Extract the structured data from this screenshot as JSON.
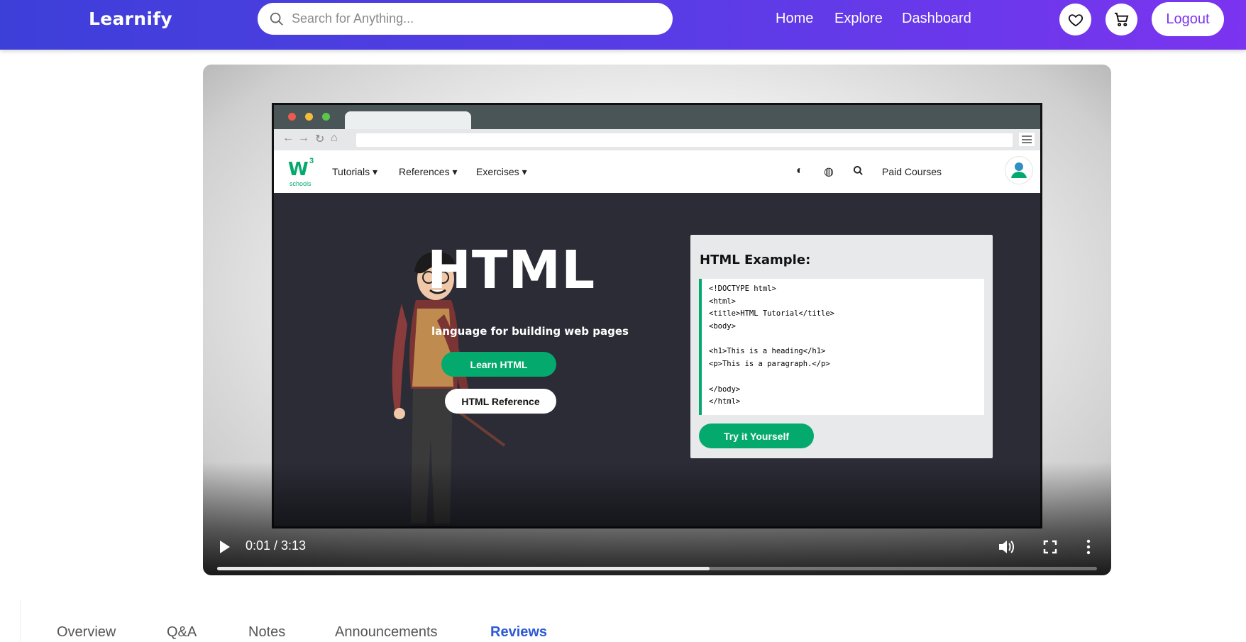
{
  "brand": "Learnify",
  "search": {
    "placeholder": "Search for Anything..."
  },
  "nav": {
    "home": "Home",
    "explore": "Explore",
    "dashboard": "Dashboard"
  },
  "actions": {
    "logout": "Logout",
    "wishlist_icon": "heart-icon",
    "cart_icon": "cart-icon"
  },
  "video": {
    "time": "0:01 / 3:13",
    "progress_buffered": 0.56,
    "frame": {
      "w3_nav": [
        "Tutorials",
        "References",
        "Exercises"
      ],
      "w3_right": "Paid Courses",
      "w3_logo": "schools",
      "hero_title": "HTML",
      "hero_subtitle": "language for building web pages",
      "learn_button": "Learn HTML",
      "reference_button": "HTML Reference",
      "example_title": "HTML Example:",
      "code": [
        "<!DOCTYPE html>",
        "<html>",
        "<title>HTML Tutorial</title>",
        "<body>",
        "",
        "<h1>This is a heading</h1>",
        "<p>This is a paragraph.</p>",
        "",
        "</body>",
        "</html>"
      ],
      "try_button": "Try it Yourself"
    }
  },
  "tabs": [
    {
      "label": "Overview",
      "active": false
    },
    {
      "label": "Q&A",
      "active": false
    },
    {
      "label": "Notes",
      "active": false
    },
    {
      "label": "Announcements",
      "active": false
    },
    {
      "label": "Reviews",
      "active": true
    }
  ],
  "colors": {
    "header_start": "#3d3fd9",
    "header_end": "#7b34ef",
    "w3_green": "#04aa6d",
    "active_tab": "#2c58d6"
  }
}
